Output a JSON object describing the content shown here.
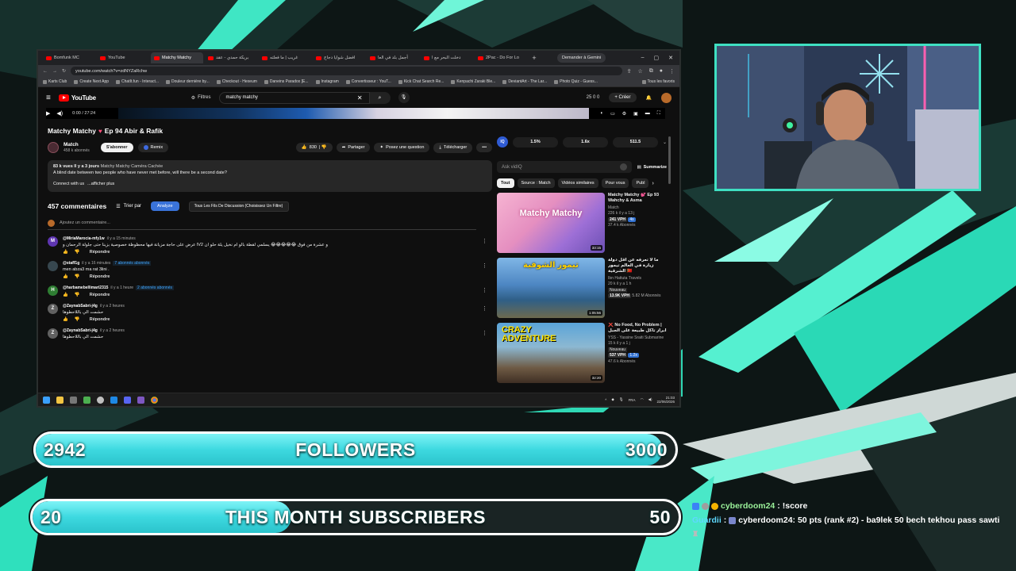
{
  "browser": {
    "tabs": [
      {
        "label": "Bomfunk MC",
        "active": false
      },
      {
        "label": "YouTube",
        "active": false
      },
      {
        "label": "Matchy Matchy",
        "active": true
      },
      {
        "label": "بريكة حمدي - عقد",
        "active": false
      },
      {
        "label": "غريب | ما فعلته",
        "active": false
      },
      {
        "label": "افضل شوايا دجاج",
        "active": false
      },
      {
        "label": "أجمل بلد في العا",
        "active": false
      },
      {
        "label": "دخلت البحر مع ا",
        "active": false
      },
      {
        "label": "2Pac - Do For Lo",
        "active": false
      }
    ],
    "new_tab": "+",
    "gemini_button": "Demander à Gemini",
    "url": "youtube.com/watch?v=zdNYZaRchw",
    "bookmarks": [
      "Karts Club",
      "Create Next App",
      "ChatIt.fun - Interact...",
      "Douleur dernière by...",
      "Checkout - Hexeum",
      "Daneins Paradox [E...",
      "Instagram",
      "Convertisseur : YouT...",
      "Kick Chat Search Re...",
      "Kenpachi Zaraki Ble...",
      "DeviantArt - The Lar...",
      "Photo Quiz - Guess..."
    ],
    "bookmarks_all": "Tous les favoris"
  },
  "youtube": {
    "logo": "YouTube",
    "filters": "Filtres",
    "search_value": "matchy matchy",
    "header_counts": "25  0  0",
    "create": "Créer",
    "player": {
      "time": "0:00 / 27:24"
    },
    "video": {
      "title": "Matchy Matchy",
      "title_suffix": "Ep 94 Abir & Rafik",
      "channel": "Match",
      "subscribers": "458 k abonnés",
      "subscribe": "S'abonner",
      "remix": "Remix",
      "likes": "830",
      "share": "Partager",
      "ask": "Posez une question",
      "download": "Télécharger"
    },
    "description": {
      "meta": "83 k vues  Il y a 3 jours",
      "tags": "Matchy Matchy Caméra Cachée",
      "text": "A blind date between two people who have never met before, will there be a second date?",
      "connect": "Connect with us",
      "more": "...afficher plus"
    },
    "comments": {
      "count": "457 commentaires",
      "sort": "Trier par",
      "analyze": "Analyze",
      "threads": "Tous Les Fils De Discussion (Choisissez Un Filtre)",
      "add_placeholder": "Ajoutez un commentaire...",
      "reply": "Répondre",
      "items": [
        {
          "initial": "M",
          "color": "#5e35b1",
          "author": "@MiriaMarocia-mfy1w",
          "ago": "il y a 15 minutes",
          "badge": "",
          "text": "عرض على حاجة مزيانة فيها محظوظة خصوصية بزينا حتى جلولة الرحمان و lV2 و عشرة من فوق 😂😂😂😂😂 يسلمي لقطة بالو ام نخيل يلة حلو ان"
        },
        {
          "initial": "",
          "color": "#37474f",
          "author": "@staff1g",
          "ago": "il y a 16 minutes",
          "badge": "7 abonnés abonnés",
          "text": "men abza3 ma rat 3lini ."
        },
        {
          "initial": "H",
          "color": "#2e7d32",
          "author": "@harbamebellimari2315",
          "ago": "il y a 1 heure",
          "badge": "2 abonnés abonnés",
          "text": ""
        },
        {
          "initial": "Z",
          "color": "#616161",
          "author": "@ZaynabSabri-j4g",
          "ago": "il y a 2 heures",
          "badge": "",
          "text": "حشمت الي باللاحطوها"
        },
        {
          "initial": "Z",
          "color": "#616161",
          "author": "@ZaynabSabri-j4g",
          "ago": "il y a 2 heures",
          "badge": "",
          "text": "حشمت الي باللاحطوها"
        }
      ]
    },
    "sidebar": {
      "stats": [
        "1.5%",
        "1.6x",
        "511.5"
      ],
      "ask_placeholder": "Ask vidIQ",
      "summarize": "Summarize",
      "chips": [
        "Tout",
        "Source : Match",
        "Vidéos similaires",
        "Pour vous",
        "Publ"
      ],
      "recommendations": [
        {
          "thumb_text": "Matchy Matchy",
          "duration": "33:15",
          "title": "Matchy Matchy 💕 Ep 93 Wahchy & Asma",
          "channel": "Match",
          "views": "226 k  il y a 13 j",
          "vph": "241 VPH",
          "ratio": "4x",
          "extra": "37.4 k Abonnés"
        },
        {
          "thumb_text": "تيمور الشوفية",
          "duration": "1:05:56",
          "title": "ما لا تعرفه عن اقل دولة زيارة في العالم تيمور الشرقية 🇹🇱",
          "channel": "Ibn Hattuta Travels",
          "views": "20 k  il y a 1 h",
          "vph": "13.9K VPH",
          "ratio": "",
          "extra": "5.82 M Abonnés",
          "new": "Nouveau"
        },
        {
          "thumb_text": "CRAZY ADVENTURE",
          "duration": "32:20",
          "title": "❌ No Food, No Problem | ابراز تاكل طبيعة على الجبل",
          "channel": "YSS - Yassine Sraiti Submarine",
          "views": "15 k  il y a 1 j",
          "vph": "537 VPH",
          "ratio": "1.2x",
          "extra": "47.6 k Abonnés",
          "new": "Nouveau"
        }
      ]
    }
  },
  "taskbar": {
    "lang": "FRA",
    "time": "21:03",
    "date": "22/06/2026"
  },
  "overlay": {
    "followers": {
      "start": "2942",
      "label": "FOLLOWERS",
      "end": "3000",
      "progress": 0.98
    },
    "subscribers": {
      "start": "20",
      "label": "THIS MONTH SUBSCRIBERS",
      "end": "50",
      "progress": 0.4
    },
    "chat": [
      {
        "user": "cyberdoom24",
        "sep": " : ",
        "msg": "!score"
      },
      {
        "user": "Guardii",
        "sep": " : ",
        "msg": "cyberdoom24: 50 pts (rank #2) - ba9lek 50 bech tekhou pass sawti"
      }
    ]
  }
}
